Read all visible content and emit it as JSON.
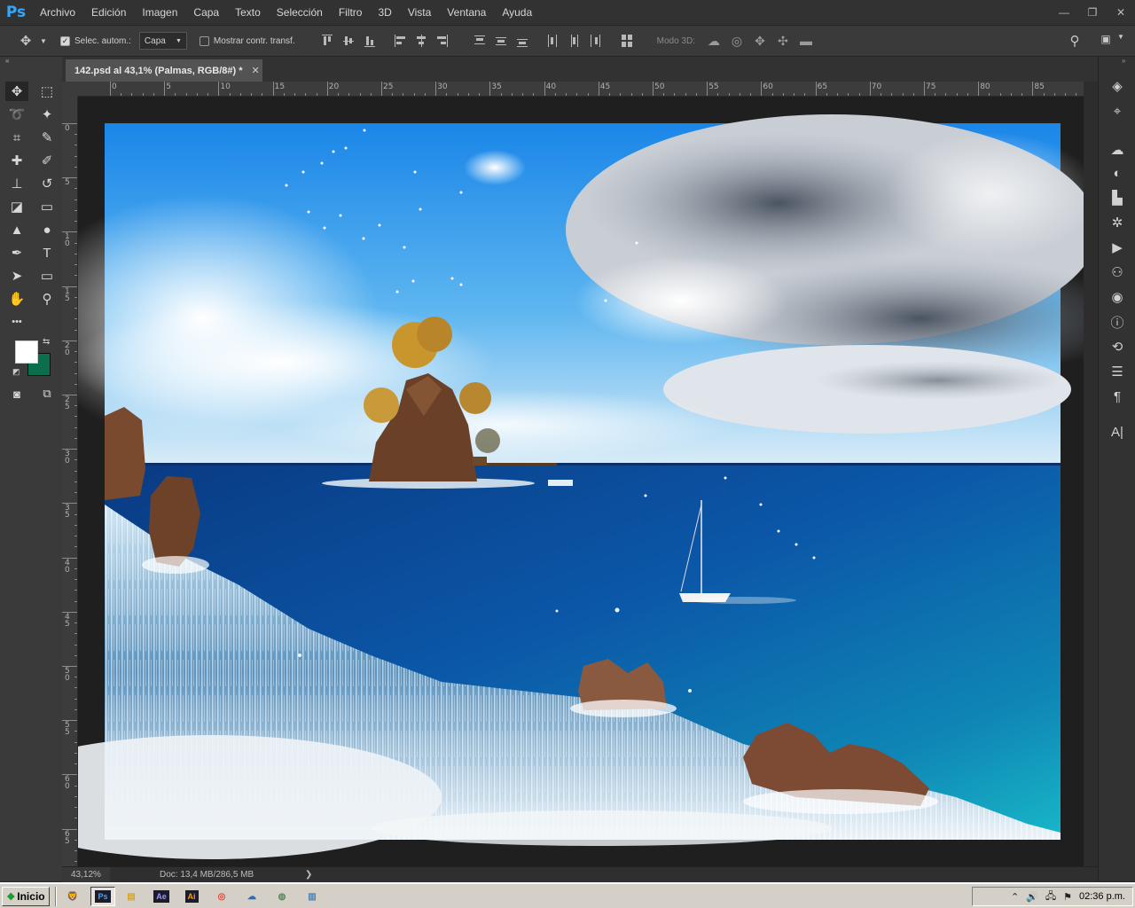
{
  "app": {
    "logo": "Ps",
    "accent": "#31a8ff"
  },
  "menu": [
    "Archivo",
    "Edición",
    "Imagen",
    "Capa",
    "Texto",
    "Selección",
    "Filtro",
    "3D",
    "Vista",
    "Ventana",
    "Ayuda"
  ],
  "window_controls": {
    "minimize": "—",
    "restore": "❐",
    "close": "✕"
  },
  "options": {
    "auto_select_checked": true,
    "auto_select_label": "Selec. autom.:",
    "auto_select_target": "Capa",
    "show_transform_checked": false,
    "show_transform_label": "Mostrar contr. transf.",
    "mode_3d_label": "Modo 3D:"
  },
  "document": {
    "tab_title": "142.psd al 43,1% (Palmas, RGB/8#) *",
    "close_glyph": "✕",
    "zoom": "43,12%",
    "doc_size": "Doc: 13,4 MB/286,5 MB",
    "status_arrow": "❯"
  },
  "rulers": {
    "top_labels": [
      "0",
      "5",
      "10",
      "15",
      "20",
      "25",
      "30",
      "35",
      "40",
      "45",
      "50",
      "55",
      "60",
      "65",
      "70",
      "75",
      "80",
      "85"
    ],
    "left_labels": [
      "0",
      "5",
      "10",
      "15",
      "20",
      "25",
      "30",
      "35",
      "40",
      "45",
      "50",
      "55",
      "60",
      "65"
    ]
  },
  "tools": [
    {
      "name": "move-tool-icon",
      "glyph": "✥"
    },
    {
      "name": "marquee-tool-icon",
      "glyph": "⬚"
    },
    {
      "name": "lasso-tool-icon",
      "glyph": "➰"
    },
    {
      "name": "magic-wand-tool-icon",
      "glyph": "✦"
    },
    {
      "name": "crop-tool-icon",
      "glyph": "⌗"
    },
    {
      "name": "eyedropper-tool-icon",
      "glyph": "✎"
    },
    {
      "name": "healing-brush-tool-icon",
      "glyph": "✚"
    },
    {
      "name": "brush-tool-icon",
      "glyph": "✐"
    },
    {
      "name": "clone-stamp-tool-icon",
      "glyph": "⊥"
    },
    {
      "name": "history-brush-tool-icon",
      "glyph": "↺"
    },
    {
      "name": "eraser-tool-icon",
      "glyph": "◪"
    },
    {
      "name": "gradient-tool-icon",
      "glyph": "▭"
    },
    {
      "name": "blur-tool-icon",
      "glyph": "▲"
    },
    {
      "name": "dodge-tool-icon",
      "glyph": "●"
    },
    {
      "name": "pen-tool-icon",
      "glyph": "✒"
    },
    {
      "name": "type-tool-icon",
      "glyph": "T"
    },
    {
      "name": "path-selection-tool-icon",
      "glyph": "➤"
    },
    {
      "name": "rectangle-tool-icon",
      "glyph": "▭"
    },
    {
      "name": "hand-tool-icon",
      "glyph": "✋"
    },
    {
      "name": "zoom-tool-icon",
      "glyph": "⚲"
    },
    {
      "name": "more-tools-icon",
      "glyph": "•••"
    }
  ],
  "colors": {
    "foreground": "#ffffff",
    "background": "#0b6e4f"
  },
  "dock": [
    {
      "name": "layers-panel-icon",
      "glyph": "◈"
    },
    {
      "name": "paths-panel-icon",
      "glyph": "⌖"
    },
    {
      "name": "libraries-panel-icon",
      "glyph": "☁"
    },
    {
      "name": "adjustments-panel-icon",
      "glyph": "◐"
    },
    {
      "name": "histogram-panel-icon",
      "glyph": "▙"
    },
    {
      "name": "brush-settings-panel-icon",
      "glyph": "✲"
    },
    {
      "name": "actions-panel-icon",
      "glyph": "▶"
    },
    {
      "name": "clone-source-panel-icon",
      "glyph": "⚇"
    },
    {
      "name": "color-panel-icon",
      "glyph": "◉"
    },
    {
      "name": "info-panel-icon",
      "glyph": "ⓘ"
    },
    {
      "name": "history-panel-icon",
      "glyph": "⟲"
    },
    {
      "name": "properties-panel-icon",
      "glyph": "☰"
    },
    {
      "name": "paragraph-panel-icon",
      "glyph": "¶"
    },
    {
      "name": "character-panel-icon",
      "glyph": "A|"
    }
  ],
  "taskbar": {
    "start_label": "Inicio",
    "apps": [
      {
        "name": "brave-taskbar-icon",
        "glyph": "🦁",
        "color": "#e8501c"
      },
      {
        "name": "photoshop-taskbar-icon",
        "glyph": "Ps",
        "color": "#31a8ff"
      },
      {
        "name": "explorer-taskbar-icon",
        "glyph": "▤",
        "color": "#d9a520"
      },
      {
        "name": "after-effects-taskbar-icon",
        "glyph": "Ae",
        "color": "#9999ff"
      },
      {
        "name": "illustrator-taskbar-icon",
        "glyph": "Ai",
        "color": "#ff9a00"
      },
      {
        "name": "chrome-taskbar-icon",
        "glyph": "◎",
        "color": "#db4437"
      },
      {
        "name": "onedrive-taskbar-icon",
        "glyph": "☁",
        "color": "#1e6fbf"
      },
      {
        "name": "media-taskbar-icon",
        "glyph": "◍",
        "color": "#5a8a5a"
      },
      {
        "name": "notepad-taskbar-icon",
        "glyph": "▥",
        "color": "#4a7fb5"
      }
    ],
    "clock": "02:36 p.m."
  }
}
